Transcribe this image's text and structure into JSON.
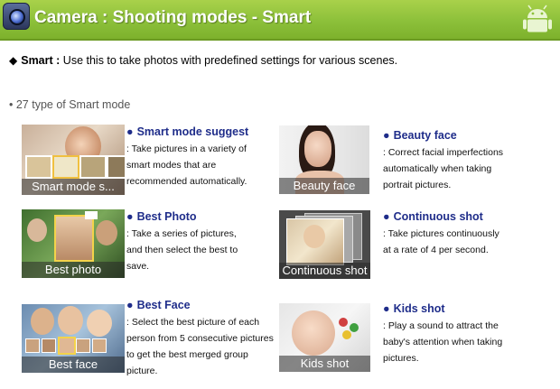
{
  "header": {
    "title": "Camera : Shooting modes - Smart",
    "camera_icon": "camera-icon",
    "android_icon": "android-robot-icon",
    "colors": {
      "bar": "#8cc03a",
      "title_text": "#ffffff"
    }
  },
  "intro": {
    "bullet": "◆",
    "label": "Smart :",
    "text": " Use this to take photos with predefined settings for various scenes."
  },
  "count_text": "• 27 type of Smart mode",
  "features": [
    {
      "bullet": "●",
      "title": "Smart mode suggest",
      "caption": "Smart mode s...",
      "lines": [
        ": Take pictures in a variety of",
        "smart modes that are",
        "recommended automatically."
      ]
    },
    {
      "bullet": "●",
      "title": "Beauty face",
      "caption": "Beauty face",
      "lines": [
        ": Correct facial imperfections",
        "automatically when taking",
        "portrait pictures."
      ]
    },
    {
      "bullet": "●",
      "title": "Best Photo",
      "caption": "Best photo",
      "lines": [
        ": Take a series of pictures,",
        "and then select the best to",
        "save."
      ]
    },
    {
      "bullet": "●",
      "title": "Continuous shot",
      "caption": "Continuous shot",
      "lines": [
        ": Take pictures continuously",
        "at a rate of 4 per second."
      ]
    },
    {
      "bullet": "●",
      "title": "Best Face",
      "caption": "Best face",
      "lines": [
        ": Select the best picture of each",
        "person from 5 consecutive pictures",
        "to get the best merged group",
        "picture."
      ]
    },
    {
      "bullet": "●",
      "title": "Kids shot",
      "caption": "Kids shot",
      "lines": [
        ": Play a sound to attract the",
        "baby's attention when taking",
        "pictures."
      ]
    }
  ],
  "colors": {
    "feature_title": "#1f2d8a",
    "caption_bg": "#282828"
  }
}
